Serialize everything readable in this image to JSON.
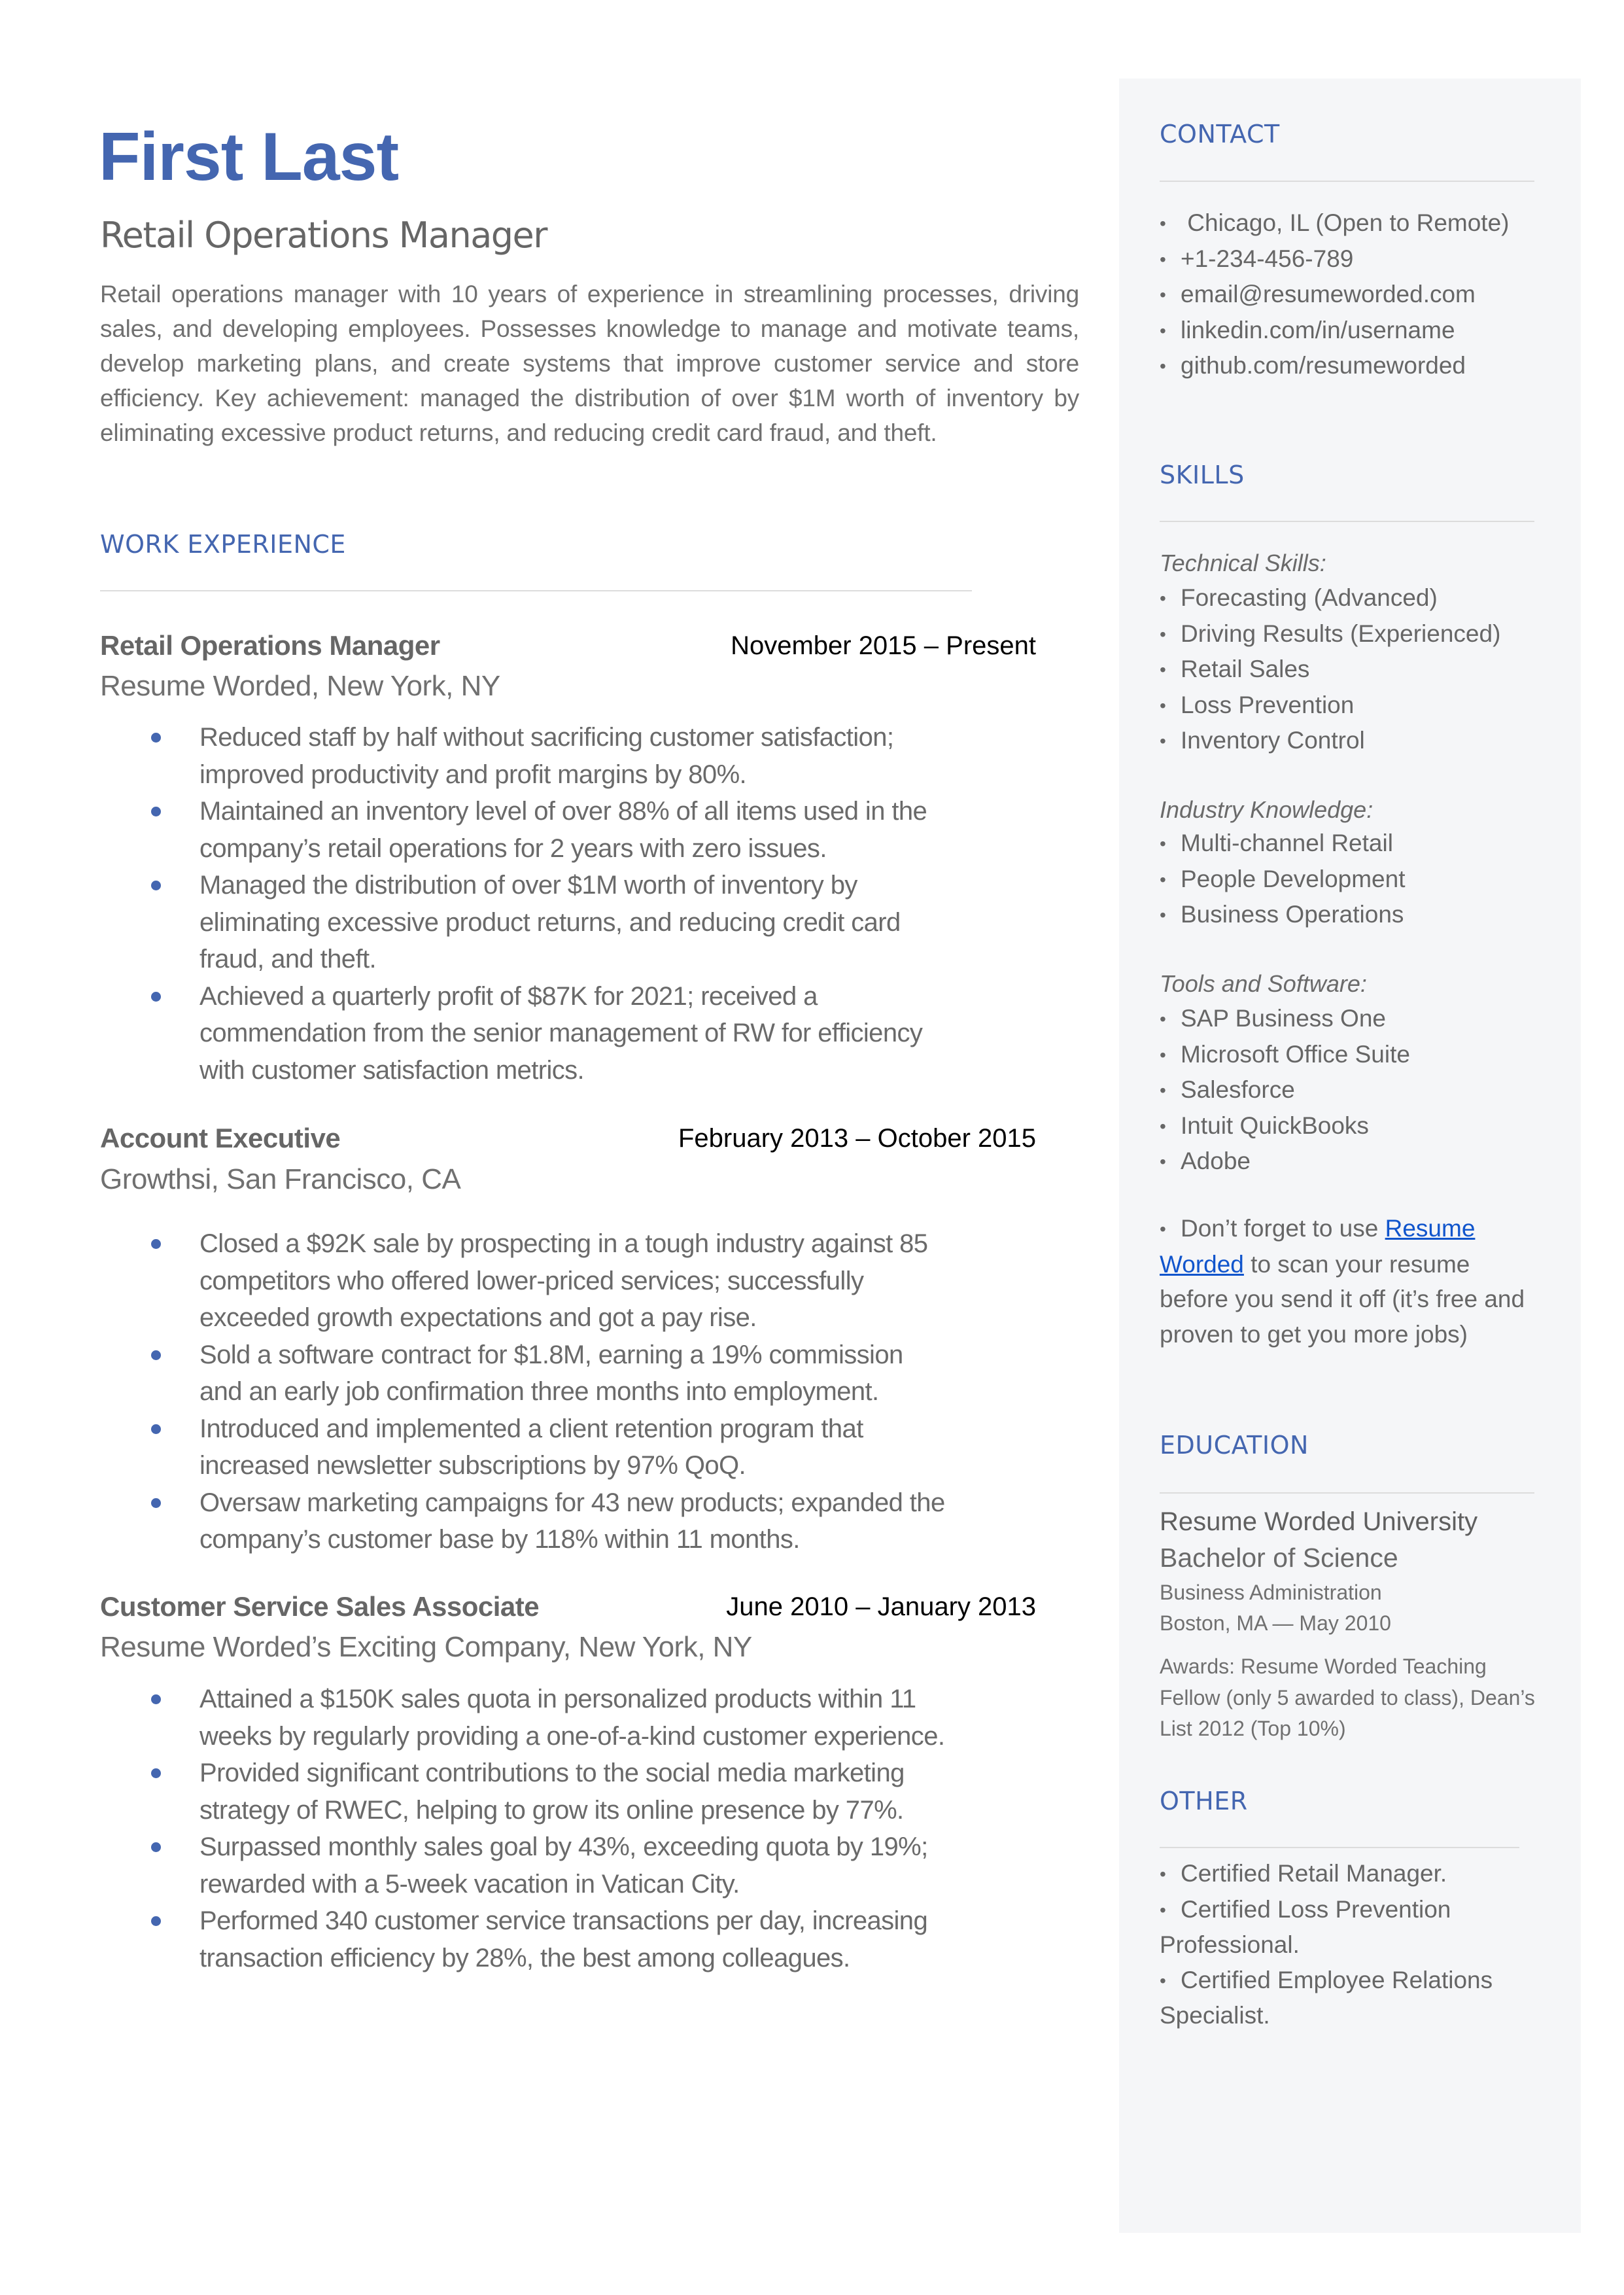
{
  "header": {
    "name": "First Last",
    "role": "Retail Operations Manager",
    "summary": "Retail operations manager with 10 years of experience in streamlining processes, driving sales, and developing employees. Possesses knowledge to manage and motivate teams, develop marketing plans, and create systems that improve customer service and store efficiency. Key achievement: managed the distribution of over $1M worth of inventory by eliminating excessive product returns, and reducing credit card fraud, and theft."
  },
  "colors": {
    "accent": "#4466b0",
    "link": "#1155cc",
    "sidebar_bg": "#f5f6f8",
    "text": "#666666"
  },
  "work": {
    "title": "WORK EXPERIENCE",
    "jobs": [
      {
        "title": "Retail Operations Manager",
        "dates": "November 2015 – Present",
        "company": "Resume Worded, New York, NY",
        "bullets": [
          "Reduced staff by half without sacrificing customer satisfaction; improved productivity and profit margins by 80%.",
          "Maintained an inventory level of over 88% of all items used in the company’s retail operations for 2 years with zero issues.",
          "Managed the distribution of over $1M worth of inventory by eliminating excessive product returns, and reducing credit card fraud, and theft.",
          "Achieved a quarterly profit of $87K for 2021; received a commendation from the senior management of RW for efficiency with customer satisfaction metrics."
        ]
      },
      {
        "title": "Account Executive",
        "dates": "February 2013 – October 2015",
        "company": "Growthsi, San Francisco, CA",
        "bullets": [
          "Closed a $92K sale by prospecting in a tough industry against 85 competitors who offered lower-priced services; successfully exceeded growth expectations and got a pay rise.",
          "Sold a software contract for $1.8M, earning a 19% commission and an early job confirmation three months into employment.",
          "Introduced and implemented a client retention program that increased newsletter subscriptions by 97% QoQ.",
          "Oversaw marketing campaigns for 43 new products; expanded the company’s customer base by 118% within 11 months."
        ]
      },
      {
        "title": "Customer Service Sales Associate",
        "dates": "June 2010 – January 2013",
        "company": "Resume Worded’s Exciting Company, New York, NY",
        "bullets": [
          "Attained a $150K sales quota in personalized products within 11 weeks by regularly providing a one-of-a-kind customer experience.",
          "Provided significant contributions to the social media marketing strategy of RWEC, helping to grow its online presence by 77%.",
          "Surpassed monthly sales goal by 43%, exceeding quota by 19%; rewarded with a 5-week vacation in Vatican City.",
          "Performed 340 customer service transactions per day, increasing transaction efficiency by 28%, the best among colleagues."
        ]
      }
    ]
  },
  "sidebar": {
    "contact": {
      "title": "CONTACT",
      "items": [
        " Chicago, IL (Open to Remote)",
        "+1-234-456-789",
        "email@resumeworded.com",
        "linkedin.com/in/username",
        "github.com/resumeworded"
      ]
    },
    "skills": {
      "title": "SKILLS",
      "groups": [
        {
          "label": "Technical Skills:",
          "items": [
            "Forecasting (Advanced)",
            "Driving Results (Experienced)",
            "Retail Sales",
            "Loss Prevention",
            "Inventory Control"
          ]
        },
        {
          "label": "Industry Knowledge:",
          "items": [
            "Multi-channel Retail",
            "People Development",
            "Business Operations"
          ]
        },
        {
          "label": "Tools and Software:",
          "items": [
            "SAP Business One",
            "Microsoft Office Suite",
            "Salesforce",
            "Intuit QuickBooks",
            "Adobe"
          ]
        }
      ],
      "tip": {
        "before": "Don’t forget to use ",
        "link": "Resume Worded",
        "after": " to scan your resume before you send it off (it’s free and proven to get you more jobs)"
      }
    },
    "education": {
      "title": "EDUCATION",
      "school": "Resume Worded University",
      "degree": "Bachelor of Science",
      "major": "Business Administration",
      "location_date": "Boston, MA — May 2010",
      "awards": "Awards: Resume Worded Teaching Fellow (only 5 awarded to class), Dean’s List 2012 (Top 10%)"
    },
    "other": {
      "title": "OTHER",
      "items": [
        "Certified Retail Manager.",
        "Certified Loss Prevention Professional.",
        "Certified Employee Relations Specialist."
      ]
    }
  }
}
